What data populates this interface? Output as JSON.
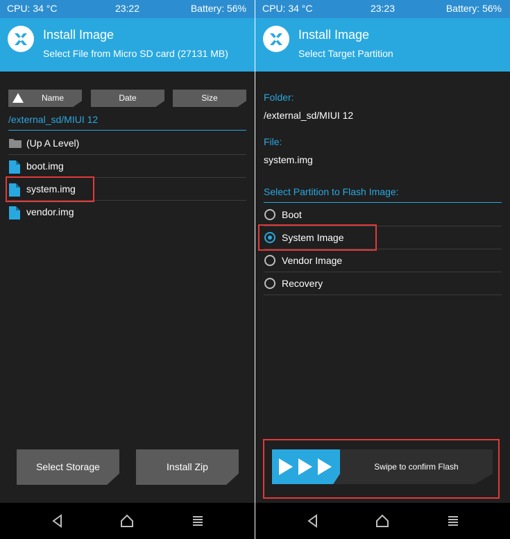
{
  "left": {
    "status": {
      "cpu": "CPU: 34 °C",
      "time": "23:22",
      "battery": "Battery: 56%"
    },
    "header": {
      "title": "Install Image",
      "subtitle": "Select File from Micro SD card (27131 MB)"
    },
    "sort": {
      "name": "Name",
      "date": "Date",
      "size": "Size"
    },
    "path": "/external_sd/MIUI 12",
    "files": [
      {
        "name": "(Up A Level)",
        "icon": "folder-icon"
      },
      {
        "name": "boot.img",
        "icon": "file-icon"
      },
      {
        "name": "system.img",
        "icon": "file-icon",
        "highlighted": true
      },
      {
        "name": "vendor.img",
        "icon": "file-icon"
      }
    ],
    "buttons": {
      "select_storage": "Select Storage",
      "install_zip": "Install Zip"
    }
  },
  "right": {
    "status": {
      "cpu": "CPU: 34 °C",
      "time": "23:23",
      "battery": "Battery: 56%"
    },
    "header": {
      "title": "Install Image",
      "subtitle": "Select Target Partition"
    },
    "folder_label": "Folder:",
    "folder_value": "/external_sd/MIUI 12",
    "file_label": "File:",
    "file_value": "system.img",
    "select_label": "Select Partition to Flash Image:",
    "partitions": [
      {
        "name": "Boot",
        "selected": false
      },
      {
        "name": "System Image",
        "selected": true
      },
      {
        "name": "Vendor Image",
        "selected": false
      },
      {
        "name": "Recovery",
        "selected": false
      }
    ],
    "swipe_text": "Swipe to confirm Flash"
  },
  "colors": {
    "accent": "#29a8e0",
    "statusbar": "#2c8ed0",
    "background": "#1f1f1f",
    "highlight": "#e23a3a"
  },
  "navbar_icons": [
    "back-icon",
    "home-icon",
    "recents-icon"
  ]
}
